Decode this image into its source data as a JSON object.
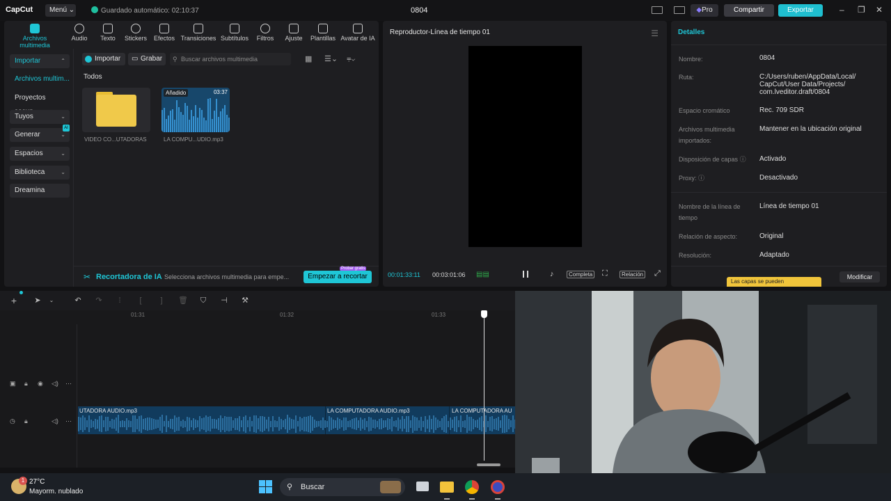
{
  "titlebar": {
    "logo": "CapCut",
    "menu_label": "Menú",
    "autosave": "Guardado automático: 02:10:37",
    "project_name": "0804",
    "pro_label": "Pro",
    "share_label": "Compartir",
    "export_label": "Exportar"
  },
  "tools": [
    {
      "label": "Archivos multimedia",
      "icon": "media-icon"
    },
    {
      "label": "Audio",
      "icon": "audio-icon"
    },
    {
      "label": "Texto",
      "icon": "text-icon"
    },
    {
      "label": "Stickers",
      "icon": "sticker-icon"
    },
    {
      "label": "Efectos",
      "icon": "effects-icon"
    },
    {
      "label": "Transiciones",
      "icon": "transitions-icon"
    },
    {
      "label": "Subtítulos",
      "icon": "subtitles-icon"
    },
    {
      "label": "Filtros",
      "icon": "filters-icon"
    },
    {
      "label": "Ajuste",
      "icon": "adjust-icon"
    },
    {
      "label": "Plantillas",
      "icon": "templates-icon"
    },
    {
      "label": "Avatar de IA",
      "icon": "ai-avatar-icon"
    }
  ],
  "left_nav": [
    {
      "label": "Importar"
    },
    {
      "label": "Archivos multim..."
    },
    {
      "label": "Proyectos secun..."
    },
    {
      "label": "Tuyos"
    },
    {
      "label": "Generar",
      "badge": "AI"
    },
    {
      "label": "Espacios"
    },
    {
      "label": "Biblioteca"
    },
    {
      "label": "Dreamina"
    }
  ],
  "media": {
    "import_label": "Importar",
    "record_label": "Grabar",
    "search_placeholder": "Buscar archivos multimedia",
    "section": "Todos",
    "items": [
      {
        "name": "VIDEO CO...UTADORAS"
      },
      {
        "name": "LA COMPU...UDIO.mp3",
        "badge": "Añadido",
        "duration": "03:37"
      }
    ],
    "ai_cutter": {
      "title": "Recortadora de IA",
      "desc": "Selecciona archivos multimedia para empe...",
      "button": "Empezar a recortar",
      "tag": "Probar gratis"
    }
  },
  "player": {
    "title": "Reproductor-Línea de tiempo 01",
    "current_time": "00:01:33:11",
    "total_time": "00:03:01:06",
    "full_label": "Completa",
    "ratio_label": "Relación"
  },
  "details": {
    "title": "Detalles",
    "rows": [
      {
        "label": "Nombre:",
        "value": "0804"
      },
      {
        "label": "Ruta:",
        "value": "C:/Users/ruben/AppData/Local/ CapCut/User Data/Projects/ com.lveditor.draft/0804"
      },
      {
        "label": "Espacio cromático",
        "value": "Rec. 709 SDR"
      },
      {
        "label": "Archivos multimedia importados:",
        "value": "Mantener en la ubicación original"
      },
      {
        "label": "Disposición de capas",
        "value": "Activado"
      },
      {
        "label": "Proxy:",
        "value": "Desactivado"
      },
      {
        "label": "Nombre de la línea de tiempo",
        "value": "Línea de tiempo 01"
      },
      {
        "label": "Relación de aspecto:",
        "value": "Original"
      },
      {
        "label": "Resolución:",
        "value": "Adaptado"
      }
    ],
    "tip": "Las capas se pueden",
    "modify_label": "Modificar"
  },
  "timeline": {
    "ruler": [
      "01:31",
      "01:32",
      "01:33"
    ],
    "clips": [
      {
        "name": "UTADORA AUDIO.mp3"
      },
      {
        "name": "LA COMPUTADORA AUDIO.mp3"
      },
      {
        "name": "LA COMPUTADORA AU"
      }
    ]
  },
  "taskbar": {
    "temp": "27°C",
    "condition": "Mayorm. nublado",
    "badge": "1",
    "search_label": "Buscar"
  },
  "colors": {
    "accent": "#1fc6d6",
    "export": "#1fbfd0",
    "audio_clip": "#113b5d",
    "folder": "#f0c94a"
  }
}
